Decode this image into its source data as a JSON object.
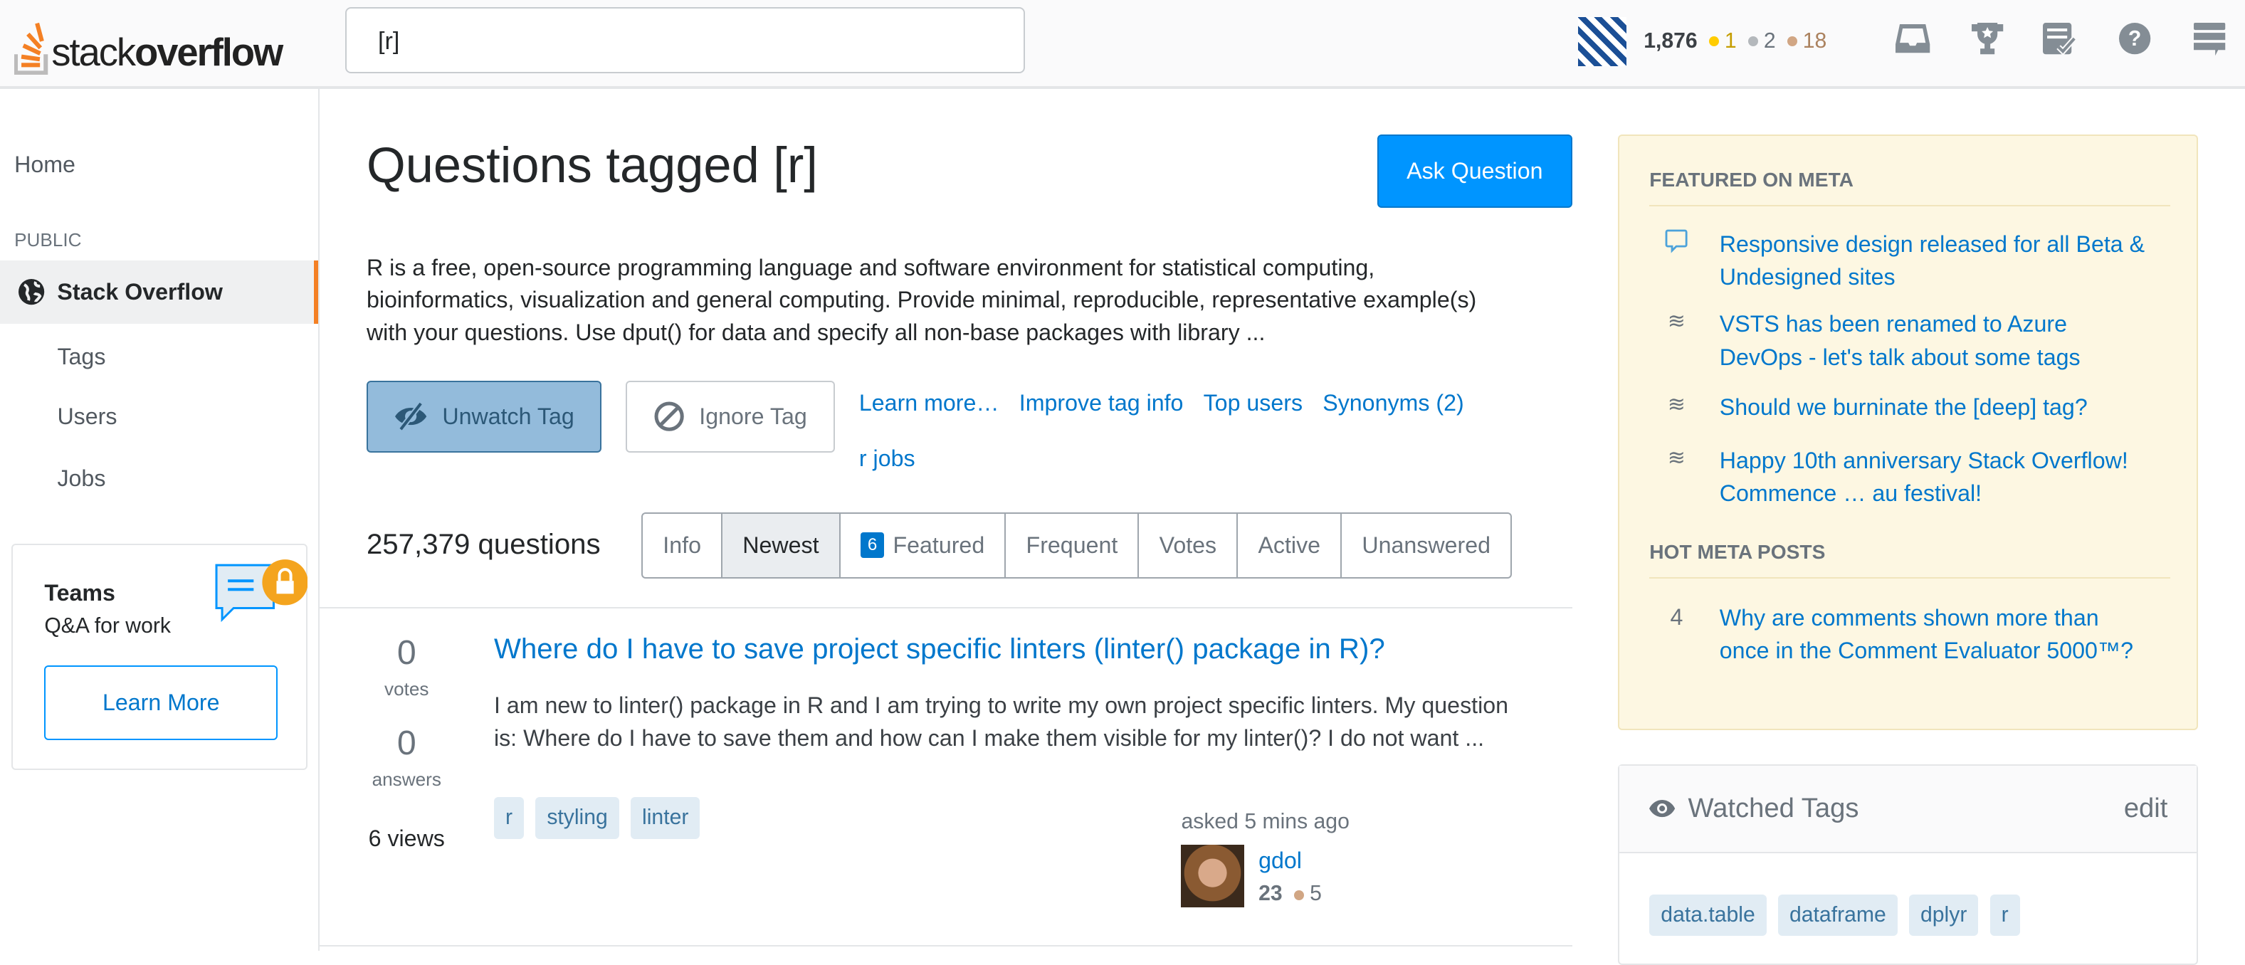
{
  "header": {
    "logo_text_light": "stack",
    "logo_text_bold": "overflow",
    "search_value": "[r]",
    "reputation": "1,876",
    "badges": {
      "gold": "1",
      "silver": "2",
      "bronze": "18"
    },
    "colors": {
      "gold": "#ffcc01",
      "silver": "#b4b8bc",
      "bronze": "#d1a684"
    },
    "icons": [
      "inbox-icon",
      "trophy-icon",
      "review-icon",
      "help-icon",
      "site-switcher-icon"
    ]
  },
  "sidebar": {
    "home": "Home",
    "public": "PUBLIC",
    "stack_overflow": "Stack Overflow",
    "tags": "Tags",
    "users": "Users",
    "jobs": "Jobs",
    "teams_title": "Teams",
    "teams_subtitle": "Q&A for work",
    "teams_button": "Learn More"
  },
  "main": {
    "title": "Questions tagged [r]",
    "ask_button": "Ask Question",
    "description": "R is a free, open-source programming language and software environment for statistical computing, bioinformatics, visualization and general computing. Provide minimal, reproducible, representative example(s) with your questions. Use dput() for data and specify all non-base packages with library ...",
    "unwatch_button": "Unwatch Tag",
    "ignore_button": "Ignore Tag",
    "links": [
      "Learn more…",
      "Improve tag info",
      "Top users",
      "Synonyms (2)",
      "r jobs"
    ],
    "question_count": "257,379 questions",
    "tabs": [
      {
        "label": "Info"
      },
      {
        "label": "Newest",
        "selected": true
      },
      {
        "label": "Featured",
        "badge": "6"
      },
      {
        "label": "Frequent"
      },
      {
        "label": "Votes"
      },
      {
        "label": "Active"
      },
      {
        "label": "Unanswered"
      }
    ],
    "questions": [
      {
        "votes": "0",
        "votes_label": "votes",
        "answers": "0",
        "answers_label": "answers",
        "views": "6 views",
        "title": "Where do I have to save project specific linters (linter() package in R)?",
        "excerpt": "I am new to linter() package in R and I am trying to write my own project specific linters. My question is: Where do I have to save them and how can I make them visible for my linter()? I do not want ...",
        "tags": [
          "r",
          "styling",
          "linter"
        ],
        "asked": "asked 5 mins ago",
        "user": "gdol",
        "user_rep": "23",
        "user_bronze": "5"
      }
    ]
  },
  "meta": {
    "featured_heading": "FEATURED ON META",
    "featured": [
      {
        "icon": "chat-bubble-icon",
        "title": "Responsive design released for all Beta & Undesigned sites"
      },
      {
        "icon": "stack-icon",
        "title": "VSTS has been renamed to Azure DevOps - let's talk about some tags"
      },
      {
        "icon": "stack-icon",
        "title": "Should we burninate the [deep] tag?"
      },
      {
        "icon": "stack-icon",
        "title": "Happy 10th anniversary Stack Overflow! Commence … au festival!"
      }
    ],
    "hot_heading": "HOT META POSTS",
    "hot": [
      {
        "score": "4",
        "title": "Why are comments shown more than once in the Comment Evaluator 5000™?"
      }
    ]
  },
  "watched": {
    "title": "Watched Tags",
    "edit": "edit",
    "tags": [
      "data.table",
      "dataframe",
      "dplyr",
      "r"
    ]
  }
}
